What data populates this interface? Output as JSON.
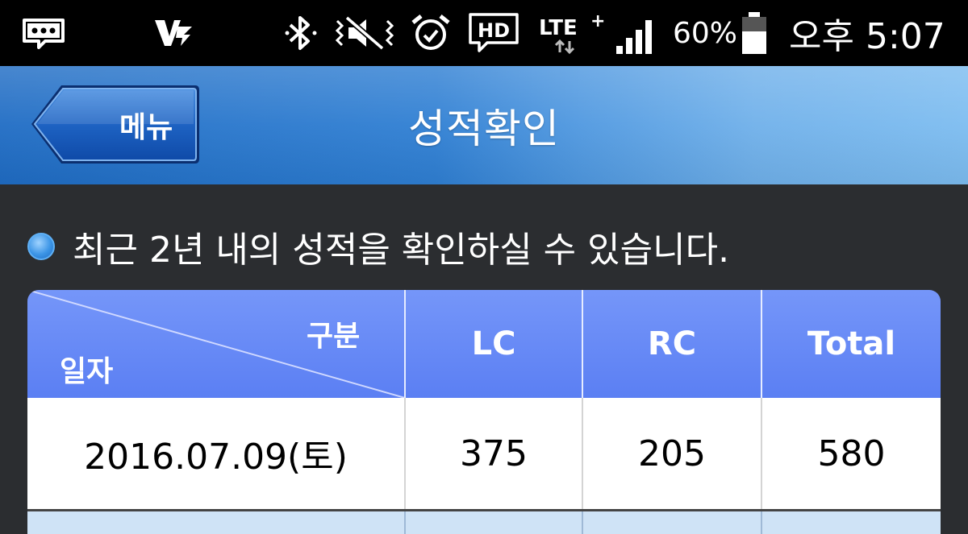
{
  "status_bar": {
    "icons": [
      "more-icon",
      "v3-app-icon",
      "bluetooth-icon",
      "vibrate-icon",
      "alarm-icon",
      "hd-voice-icon",
      "lte-plus-icon",
      "signal-icon",
      "battery-icon"
    ],
    "lte_label": "LTE",
    "lte_plus": "+",
    "hd_label": "HD",
    "battery_percent": "60%",
    "battery_level": 0.6,
    "time": "오후 5:07"
  },
  "header": {
    "menu_label": "메뉴",
    "title": "성적확인"
  },
  "notice": {
    "text": "최근 2년 내의 성적을 확인하실 수 있습니다."
  },
  "table": {
    "header_category": "구분",
    "header_date": "일자",
    "columns": [
      "LC",
      "RC",
      "Total"
    ],
    "rows": [
      {
        "date": "2016.07.09(토)",
        "lc": "375",
        "rc": "205",
        "total": "580"
      }
    ]
  },
  "colors": {
    "titlebar_start": "#1f6cc4",
    "titlebar_end": "#7cbcf0",
    "table_header": "#6689f5",
    "background": "#2b2d30"
  }
}
